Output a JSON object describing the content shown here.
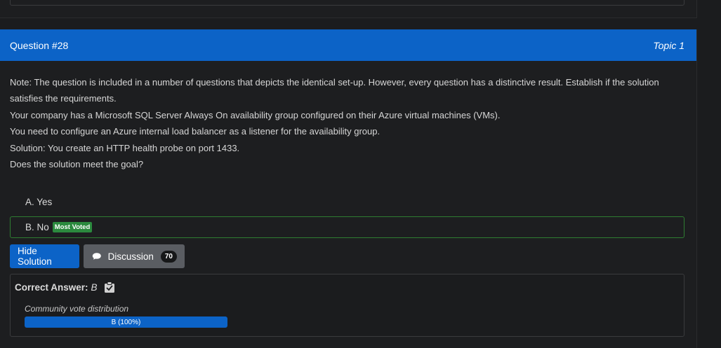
{
  "question": {
    "number_label": "Question #28",
    "topic_label": "Topic 1",
    "paragraphs": [
      "Note: The question is included in a number of questions that depicts the identical set-up. However, every question has a distinctive result. Establish if the solution satisfies the requirements.",
      "Your company has a Microsoft SQL Server Always On availability group configured on their Azure virtual machines (VMs).",
      "You need to configure an Azure internal load balancer as a listener for the availability group.",
      "Solution: You create an HTTP health probe on port 1433.",
      "Does the solution meet the goal?"
    ]
  },
  "choices": [
    {
      "label": "A. Yes",
      "selected": false,
      "badge": ""
    },
    {
      "label": "B. No",
      "selected": true,
      "badge": "Most Voted"
    }
  ],
  "buttons": {
    "hide_solution": "Hide Solution",
    "discussion": "Discussion",
    "discussion_count": "70"
  },
  "answer": {
    "correct_label": "Correct Answer:",
    "correct_value": "B",
    "vote_label": "Community vote distribution",
    "vote_bar_text": "B (100%)",
    "vote_fraction": 1.0
  },
  "colors": {
    "header_blue": "#0c63c7",
    "voted_green": "#2b8a3e",
    "selected_border": "#2f7d32",
    "background": "#1b1c1e"
  },
  "icons": {
    "discussion": "comment-bubble-icon",
    "answer_reveal": "clipboard-icon"
  }
}
